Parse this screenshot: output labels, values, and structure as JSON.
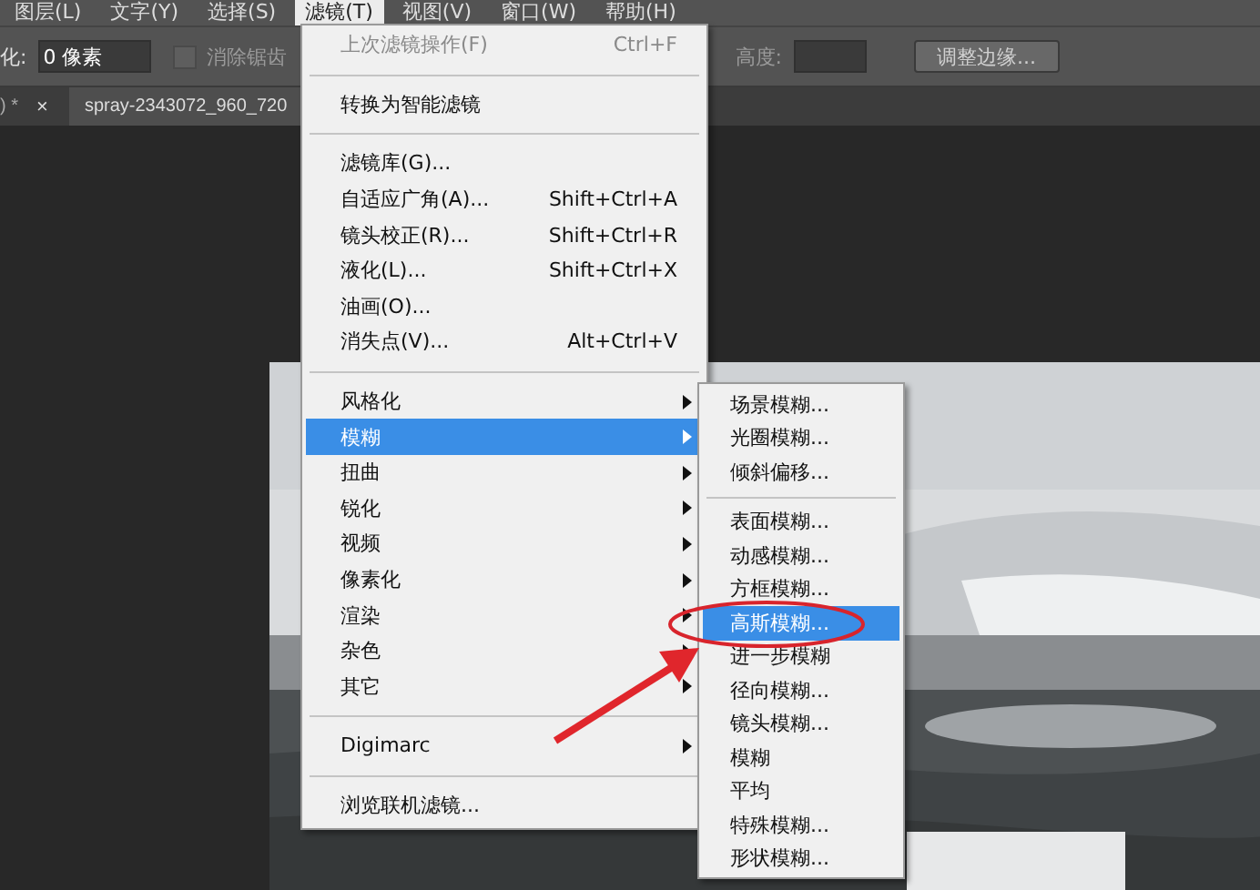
{
  "menubar": [
    {
      "label": "图层(L)",
      "selected": false
    },
    {
      "label": "文字(Y)",
      "selected": false
    },
    {
      "label": "选择(S)",
      "selected": false
    },
    {
      "label": "滤镜(T)",
      "selected": true
    },
    {
      "label": "视图(V)",
      "selected": false
    },
    {
      "label": "窗口(W)",
      "selected": false
    },
    {
      "label": "帮助(H)",
      "selected": false
    }
  ],
  "options_bar": {
    "feather_label": "化:",
    "feather_value": "0 像素",
    "anti_alias": {
      "label": "消除锯齿",
      "checked": false
    },
    "height_label": "高度:",
    "refine_button": "调整边缘..."
  },
  "tabs": [
    {
      "label": ") *",
      "close": "×",
      "selected": false
    },
    {
      "label": "spray-2343072_960_720",
      "selected": true
    }
  ],
  "filter_menu": {
    "groups": [
      [
        {
          "label": "上次滤镜操作(F)",
          "shortcut": "Ctrl+F",
          "disabled": true,
          "has_submenu": false,
          "selected": false
        }
      ],
      [
        {
          "label": "转换为智能滤镜",
          "disabled": false,
          "has_submenu": false,
          "selected": false
        }
      ],
      [
        {
          "label": "滤镜库(G)...",
          "disabled": false,
          "has_submenu": false,
          "selected": false
        },
        {
          "label": "自适应广角(A)...",
          "shortcut": "Shift+Ctrl+A",
          "disabled": false,
          "has_submenu": false,
          "selected": false
        },
        {
          "label": "镜头校正(R)...",
          "shortcut": "Shift+Ctrl+R",
          "disabled": false,
          "has_submenu": false,
          "selected": false
        },
        {
          "label": "液化(L)...",
          "shortcut": "Shift+Ctrl+X",
          "disabled": false,
          "has_submenu": false,
          "selected": false
        },
        {
          "label": "油画(O)...",
          "disabled": false,
          "has_submenu": false,
          "selected": false
        },
        {
          "label": "消失点(V)...",
          "shortcut": "Alt+Ctrl+V",
          "disabled": false,
          "has_submenu": false,
          "selected": false
        }
      ],
      [
        {
          "label": "风格化",
          "disabled": false,
          "has_submenu": true,
          "selected": false
        },
        {
          "label": "模糊",
          "disabled": false,
          "has_submenu": true,
          "selected": true
        },
        {
          "label": "扭曲",
          "disabled": false,
          "has_submenu": true,
          "selected": false
        },
        {
          "label": "锐化",
          "disabled": false,
          "has_submenu": true,
          "selected": false
        },
        {
          "label": "视频",
          "disabled": false,
          "has_submenu": true,
          "selected": false
        },
        {
          "label": "像素化",
          "disabled": false,
          "has_submenu": true,
          "selected": false
        },
        {
          "label": "渲染",
          "disabled": false,
          "has_submenu": true,
          "selected": false
        },
        {
          "label": "杂色",
          "disabled": false,
          "has_submenu": true,
          "selected": false
        },
        {
          "label": "其它",
          "disabled": false,
          "has_submenu": true,
          "selected": false
        }
      ],
      [
        {
          "label": "Digimarc",
          "disabled": false,
          "has_submenu": true,
          "selected": false
        }
      ],
      [
        {
          "label": "浏览联机滤镜...",
          "disabled": false,
          "has_submenu": false,
          "selected": false
        }
      ]
    ]
  },
  "blur_submenu": {
    "groups": [
      [
        {
          "label": "场景模糊...",
          "selected": false
        },
        {
          "label": "光圈模糊...",
          "selected": false
        },
        {
          "label": "倾斜偏移...",
          "selected": false
        }
      ],
      [
        {
          "label": "表面模糊...",
          "selected": false
        },
        {
          "label": "动感模糊...",
          "selected": false
        },
        {
          "label": "方框模糊...",
          "selected": false
        },
        {
          "label": "高斯模糊...",
          "selected": true
        },
        {
          "label": "进一步模糊",
          "selected": false
        },
        {
          "label": "径向模糊...",
          "selected": false
        },
        {
          "label": "镜头模糊...",
          "selected": false
        },
        {
          "label": "模糊",
          "selected": false
        },
        {
          "label": "平均",
          "selected": false
        },
        {
          "label": "特殊模糊...",
          "selected": false
        },
        {
          "label": "形状模糊...",
          "selected": false
        }
      ]
    ]
  }
}
